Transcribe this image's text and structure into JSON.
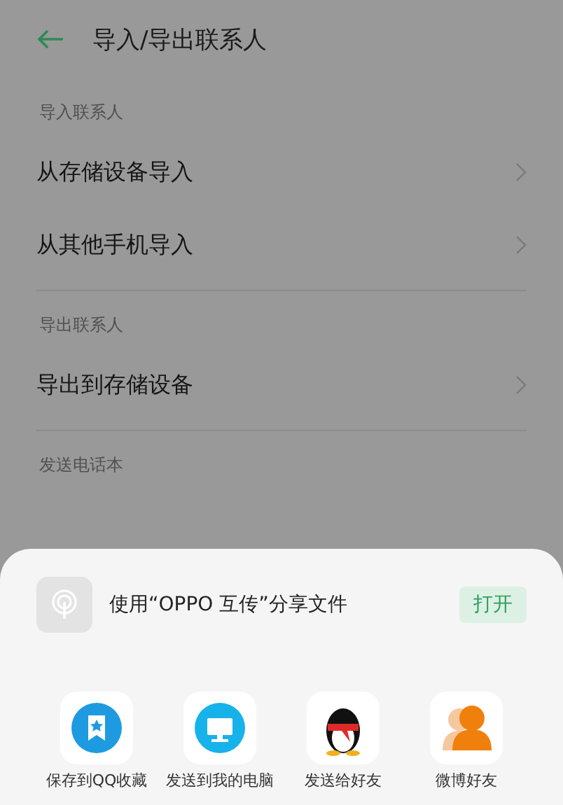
{
  "header": {
    "title": "导入/导出联系人"
  },
  "sections": [
    {
      "label": "导入联系人",
      "items": [
        {
          "label": "从存储设备导入"
        },
        {
          "label": "从其他手机导入"
        }
      ]
    },
    {
      "label": "导出联系人",
      "items": [
        {
          "label": "导出到存储设备"
        }
      ]
    },
    {
      "label": "发送电话本"
    }
  ],
  "share_sheet": {
    "nearby": {
      "label": "使用“OPPO 互传”分享文件",
      "action": "打开"
    },
    "targets": [
      {
        "kind": "favorites",
        "label": "保存到QQ收藏"
      },
      {
        "kind": "computer",
        "label": "发送到我的电脑"
      },
      {
        "kind": "friend",
        "label": "发送给好友"
      },
      {
        "kind": "weibo",
        "label": "微博好友"
      }
    ]
  }
}
